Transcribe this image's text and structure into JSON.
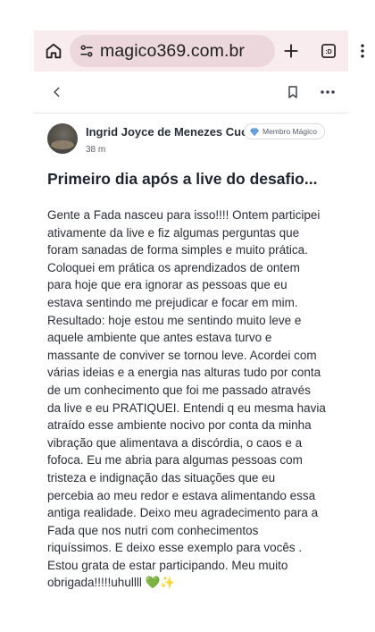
{
  "browser": {
    "url": "magico369.com.br",
    "tab_count_icon": ":D"
  },
  "post": {
    "author": {
      "name": "Ingrid Joyce de Menezes Cuco",
      "badge": "Membro Mágico",
      "time": "38 m"
    },
    "title": "Primeiro dia após a live do desafio...",
    "body_lines": [
      "Gente a Fada nasceu para isso!!!! Ontem participei",
      "ativamente da live e fiz algumas perguntas que",
      "foram sanadas de forma simples e muito prática.",
      "Coloquei em prática os aprendizados de ontem",
      "para hoje que era ignorar as pessoas que eu",
      "estava sentindo me prejudicar e focar em mim.",
      "Resultado: hoje estou me sentindo muito leve e",
      "aquele ambiente que antes estava turvo e",
      "massante de conviver se tornou leve. Acordei com",
      "várias ideias e a energia nas alturas tudo por conta",
      "de um conhecimento que foi me passado através",
      "da live e eu PRATIQUEI. Entendi q eu mesma havia",
      "atraído esse ambiente nocivo por conta da minha",
      "vibração que alimentava a discórdia, o caos e a",
      "fofoca. Eu me abria para algumas pessoas com",
      "tristeza e indignação das situações que eu",
      "percebia ao meu redor e estava alimentando essa",
      "antiga realidade. Deixo meu agradecimento para a",
      "Fada que nos nutri com conhecimentos",
      "riquíssimos. E deixo esse exemplo para vocês .",
      "Estou grata de estar participando. Meu muito",
      "obrigada!!!!!uhullll 💚✨"
    ]
  }
}
